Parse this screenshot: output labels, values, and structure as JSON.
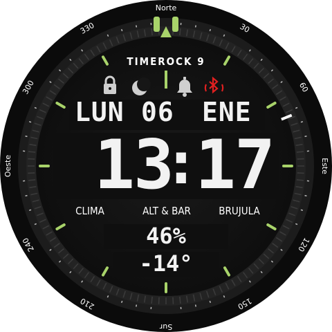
{
  "bezel": {
    "north": "Norte",
    "east": "Este",
    "south": "Sur",
    "west": "Oeste",
    "degrees": [
      "30",
      "60",
      "120",
      "150",
      "210",
      "240",
      "300",
      "330"
    ]
  },
  "brand": "TIMEROCK 9",
  "status_icons": [
    "lock-icon",
    "moon-icon",
    "bell-icon",
    "bluetooth-off-icon"
  ],
  "date": {
    "weekday": "LUN",
    "day": "06",
    "month": "ENE"
  },
  "time": {
    "hours": "13",
    "sep": ":",
    "minutes": "17"
  },
  "shortcuts": {
    "weather": "CLIMA",
    "altbar": "ALT & BAR",
    "compass": "BRUJULA"
  },
  "stats": {
    "battery": "46%",
    "temperature": "-14°"
  },
  "colors": {
    "accent": "#a8d36a",
    "alert": "#e02020",
    "face": "#151515",
    "bezel": "#0c0c0c"
  }
}
